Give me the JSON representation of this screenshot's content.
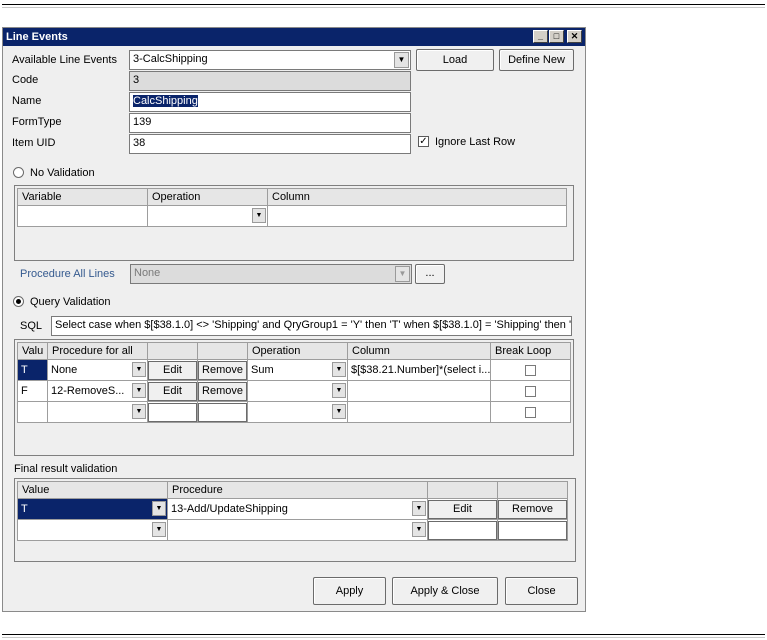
{
  "window": {
    "title": "Line Events",
    "controls": {
      "minimize": "_",
      "maximize": "□",
      "close": "✕"
    }
  },
  "form": {
    "available_label": "Available Line Events",
    "available_value": "3-CalcShipping",
    "load_button": "Load",
    "define_new_button": "Define New",
    "code_label": "Code",
    "code_value": "3",
    "name_label": "Name",
    "name_value": "CalcShipping",
    "formtype_label": "FormType",
    "formtype_value": "139",
    "itemuid_label": "Item UID",
    "itemuid_value": "38",
    "ignore_last_row_label": "Ignore Last Row",
    "ignore_last_row_checked": true
  },
  "no_validation": {
    "label": "No Validation",
    "columns": [
      "Variable",
      "Operation",
      "Column"
    ],
    "procedure_label": "Procedure All Lines",
    "procedure_value": "None",
    "ellipsis_button": "..."
  },
  "query_validation": {
    "label": "Query Validation",
    "sql_label": "SQL",
    "sql_value": "Select case when $[$38.1.0] <> 'Shipping' and QryGroup1 = 'Y' then 'T' when $[$38.1.0] = 'Shipping' then 'F' e",
    "columns": [
      "Valu",
      "Procedure for all",
      "",
      "",
      "Operation",
      "Column",
      "Break Loop"
    ],
    "rows": [
      {
        "value": "T",
        "procedure": "None",
        "edit": "Edit",
        "remove": "Remove",
        "operation": "Sum",
        "column": "$[$38.21.Number]*(select i..."
      },
      {
        "value": "F",
        "procedure": "12-RemoveS...",
        "edit": "Edit",
        "remove": "Remove",
        "operation": "",
        "column": ""
      },
      {
        "value": "",
        "procedure": "",
        "edit": "",
        "remove": "",
        "operation": "",
        "column": ""
      }
    ]
  },
  "final_validation": {
    "label": "Final result validation",
    "columns": [
      "Value",
      "Procedure",
      "",
      ""
    ],
    "rows": [
      {
        "value": "T",
        "procedure": "13-Add/UpdateShipping",
        "edit": "Edit",
        "remove": "Remove"
      },
      {
        "value": "",
        "procedure": "",
        "edit": "",
        "remove": ""
      }
    ]
  },
  "footer": {
    "apply": "Apply",
    "apply_close": "Apply & Close",
    "close": "Close"
  },
  "colors": {
    "titlebar": "#0a246a",
    "selection": "#0a246a",
    "window_bg": "#efefef"
  }
}
